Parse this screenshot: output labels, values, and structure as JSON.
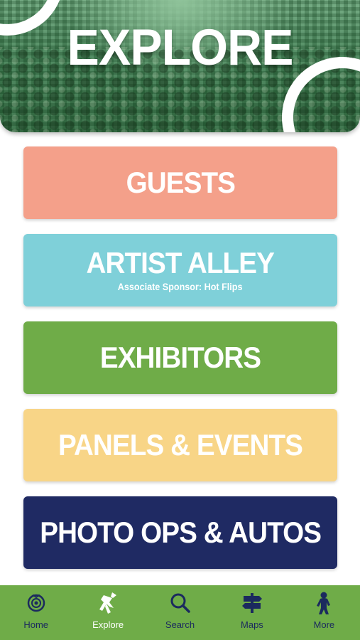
{
  "header": {
    "title": "EXPLORE"
  },
  "menu": [
    {
      "label": "GUESTS",
      "subtitle": "",
      "color": "#f4a08a"
    },
    {
      "label": "ARTIST ALLEY",
      "subtitle": "Associate Sponsor: Hot Flips",
      "color": "#7fd0d9"
    },
    {
      "label": "EXHIBITORS",
      "subtitle": "",
      "color": "#6fac48"
    },
    {
      "label": "PANELS & EVENTS",
      "subtitle": "",
      "color": "#f8d587"
    },
    {
      "label": "PHOTO OPS & AUTOS",
      "subtitle": "",
      "color": "#1f2a63"
    }
  ],
  "tabbar": {
    "background": "#6fac48",
    "items": [
      {
        "label": "Home",
        "icon": "home-logo-icon",
        "active": false
      },
      {
        "label": "Explore",
        "icon": "explore-figure-icon",
        "active": true
      },
      {
        "label": "Search",
        "icon": "search-icon",
        "active": false
      },
      {
        "label": "Maps",
        "icon": "signpost-icon",
        "active": false
      },
      {
        "label": "More",
        "icon": "bigfoot-icon",
        "active": false
      }
    ]
  }
}
